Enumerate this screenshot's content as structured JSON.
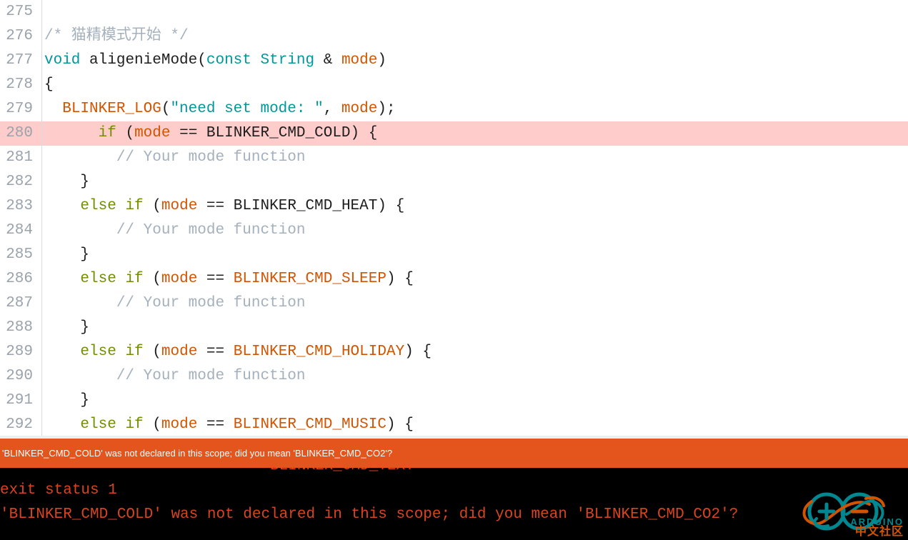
{
  "app": {
    "name": "Arduino IDE",
    "theme": "light"
  },
  "editor": {
    "language": "cpp",
    "first_visible_line": 275,
    "highlighted_line": 280,
    "colors": {
      "background": "#ffffff",
      "gutter_text": "#9aa2ab",
      "gutter_rule": "#d7dade",
      "error_line_background": "#ffcccc",
      "keyword": "#00979c",
      "control": "#728e00",
      "variable": "#d35400",
      "literal": "#00979c",
      "comment": "#a4b1bd",
      "plain": "#1d1d1d"
    },
    "lines": [
      {
        "n": "275",
        "highlight": false,
        "tokens": []
      },
      {
        "n": "276",
        "highlight": false,
        "tokens": [
          {
            "t": "/* 猫精模式开始 */",
            "c": "t-cmt"
          }
        ]
      },
      {
        "n": "277",
        "highlight": false,
        "tokens": [
          {
            "t": "void",
            "c": "t-kw"
          },
          {
            "t": " ",
            "c": "t-plain"
          },
          {
            "t": "aligenieMode",
            "c": "t-fn"
          },
          {
            "t": "(",
            "c": "t-plain"
          },
          {
            "t": "const",
            "c": "t-kw"
          },
          {
            "t": " ",
            "c": "t-plain"
          },
          {
            "t": "String",
            "c": "t-kw"
          },
          {
            "t": " & ",
            "c": "t-plain"
          },
          {
            "t": "mode",
            "c": "t-var"
          },
          {
            "t": ")",
            "c": "t-plain"
          }
        ]
      },
      {
        "n": "278",
        "highlight": false,
        "tokens": [
          {
            "t": "{",
            "c": "t-plain"
          }
        ]
      },
      {
        "n": "279",
        "highlight": false,
        "tokens": [
          {
            "t": "  ",
            "c": "t-plain"
          },
          {
            "t": "BLINKER_LOG",
            "c": "t-var"
          },
          {
            "t": "(",
            "c": "t-plain"
          },
          {
            "t": "\"need set mode: \"",
            "c": "t-lit"
          },
          {
            "t": ", ",
            "c": "t-plain"
          },
          {
            "t": "mode",
            "c": "t-var"
          },
          {
            "t": ");",
            "c": "t-plain"
          }
        ]
      },
      {
        "n": "280",
        "highlight": true,
        "tokens": [
          {
            "t": "      ",
            "c": "t-plain"
          },
          {
            "t": "if",
            "c": "t-ctl"
          },
          {
            "t": " (",
            "c": "t-plain"
          },
          {
            "t": "mode",
            "c": "t-var"
          },
          {
            "t": " == ",
            "c": "t-plain"
          },
          {
            "t": "BLINKER_CMD_COLD",
            "c": "t-plain"
          },
          {
            "t": ") {",
            "c": "t-plain"
          }
        ]
      },
      {
        "n": "281",
        "highlight": false,
        "tokens": [
          {
            "t": "        ",
            "c": "t-plain"
          },
          {
            "t": "// Your mode function",
            "c": "t-cmt"
          }
        ]
      },
      {
        "n": "282",
        "highlight": false,
        "tokens": [
          {
            "t": "    }",
            "c": "t-plain"
          }
        ]
      },
      {
        "n": "283",
        "highlight": false,
        "tokens": [
          {
            "t": "    ",
            "c": "t-plain"
          },
          {
            "t": "else",
            "c": "t-ctl"
          },
          {
            "t": " ",
            "c": "t-plain"
          },
          {
            "t": "if",
            "c": "t-ctl"
          },
          {
            "t": " (",
            "c": "t-plain"
          },
          {
            "t": "mode",
            "c": "t-var"
          },
          {
            "t": " == ",
            "c": "t-plain"
          },
          {
            "t": "BLINKER_CMD_HEAT",
            "c": "t-plain"
          },
          {
            "t": ") {",
            "c": "t-plain"
          }
        ]
      },
      {
        "n": "284",
        "highlight": false,
        "tokens": [
          {
            "t": "        ",
            "c": "t-plain"
          },
          {
            "t": "// Your mode function",
            "c": "t-cmt"
          }
        ]
      },
      {
        "n": "285",
        "highlight": false,
        "tokens": [
          {
            "t": "    }",
            "c": "t-plain"
          }
        ]
      },
      {
        "n": "286",
        "highlight": false,
        "tokens": [
          {
            "t": "    ",
            "c": "t-plain"
          },
          {
            "t": "else",
            "c": "t-ctl"
          },
          {
            "t": " ",
            "c": "t-plain"
          },
          {
            "t": "if",
            "c": "t-ctl"
          },
          {
            "t": " (",
            "c": "t-plain"
          },
          {
            "t": "mode",
            "c": "t-var"
          },
          {
            "t": " == ",
            "c": "t-plain"
          },
          {
            "t": "BLINKER_CMD_SLEEP",
            "c": "t-var"
          },
          {
            "t": ") {",
            "c": "t-plain"
          }
        ]
      },
      {
        "n": "287",
        "highlight": false,
        "tokens": [
          {
            "t": "        ",
            "c": "t-plain"
          },
          {
            "t": "// Your mode function",
            "c": "t-cmt"
          }
        ]
      },
      {
        "n": "288",
        "highlight": false,
        "tokens": [
          {
            "t": "    }",
            "c": "t-plain"
          }
        ]
      },
      {
        "n": "289",
        "highlight": false,
        "tokens": [
          {
            "t": "    ",
            "c": "t-plain"
          },
          {
            "t": "else",
            "c": "t-ctl"
          },
          {
            "t": " ",
            "c": "t-plain"
          },
          {
            "t": "if",
            "c": "t-ctl"
          },
          {
            "t": " (",
            "c": "t-plain"
          },
          {
            "t": "mode",
            "c": "t-var"
          },
          {
            "t": " == ",
            "c": "t-plain"
          },
          {
            "t": "BLINKER_CMD_HOLIDAY",
            "c": "t-var"
          },
          {
            "t": ") {",
            "c": "t-plain"
          }
        ]
      },
      {
        "n": "290",
        "highlight": false,
        "tokens": [
          {
            "t": "        ",
            "c": "t-plain"
          },
          {
            "t": "// Your mode function",
            "c": "t-cmt"
          }
        ]
      },
      {
        "n": "291",
        "highlight": false,
        "tokens": [
          {
            "t": "    }",
            "c": "t-plain"
          }
        ]
      },
      {
        "n": "292",
        "highlight": false,
        "tokens": [
          {
            "t": "    ",
            "c": "t-plain"
          },
          {
            "t": "else",
            "c": "t-ctl"
          },
          {
            "t": " ",
            "c": "t-plain"
          },
          {
            "t": "if",
            "c": "t-ctl"
          },
          {
            "t": " (",
            "c": "t-plain"
          },
          {
            "t": "mode",
            "c": "t-var"
          },
          {
            "t": " == ",
            "c": "t-plain"
          },
          {
            "t": "BLINKER_CMD_MUSIC",
            "c": "t-var"
          },
          {
            "t": ") {",
            "c": "t-plain"
          }
        ]
      }
    ]
  },
  "error_bar": {
    "message": "'BLINKER_CMD_COLD' was not declared in this scope; did you mean 'BLINKER_CMD_CO2'?",
    "background": "#e4551d",
    "text_color": "#ffffff"
  },
  "console": {
    "background": "#000000",
    "text_color": "#d9441f",
    "lines": [
      "                              BLINKER_CMD_TEXT",
      "exit status 1",
      "'BLINKER_CMD_COLD' was not declared in this scope; did you mean 'BLINKER_CMD_CO2'?"
    ]
  },
  "watermark": {
    "brand": "ARDUINO",
    "subtitle": "中文社区",
    "teal": "#00878f",
    "orange": "#d35400"
  }
}
